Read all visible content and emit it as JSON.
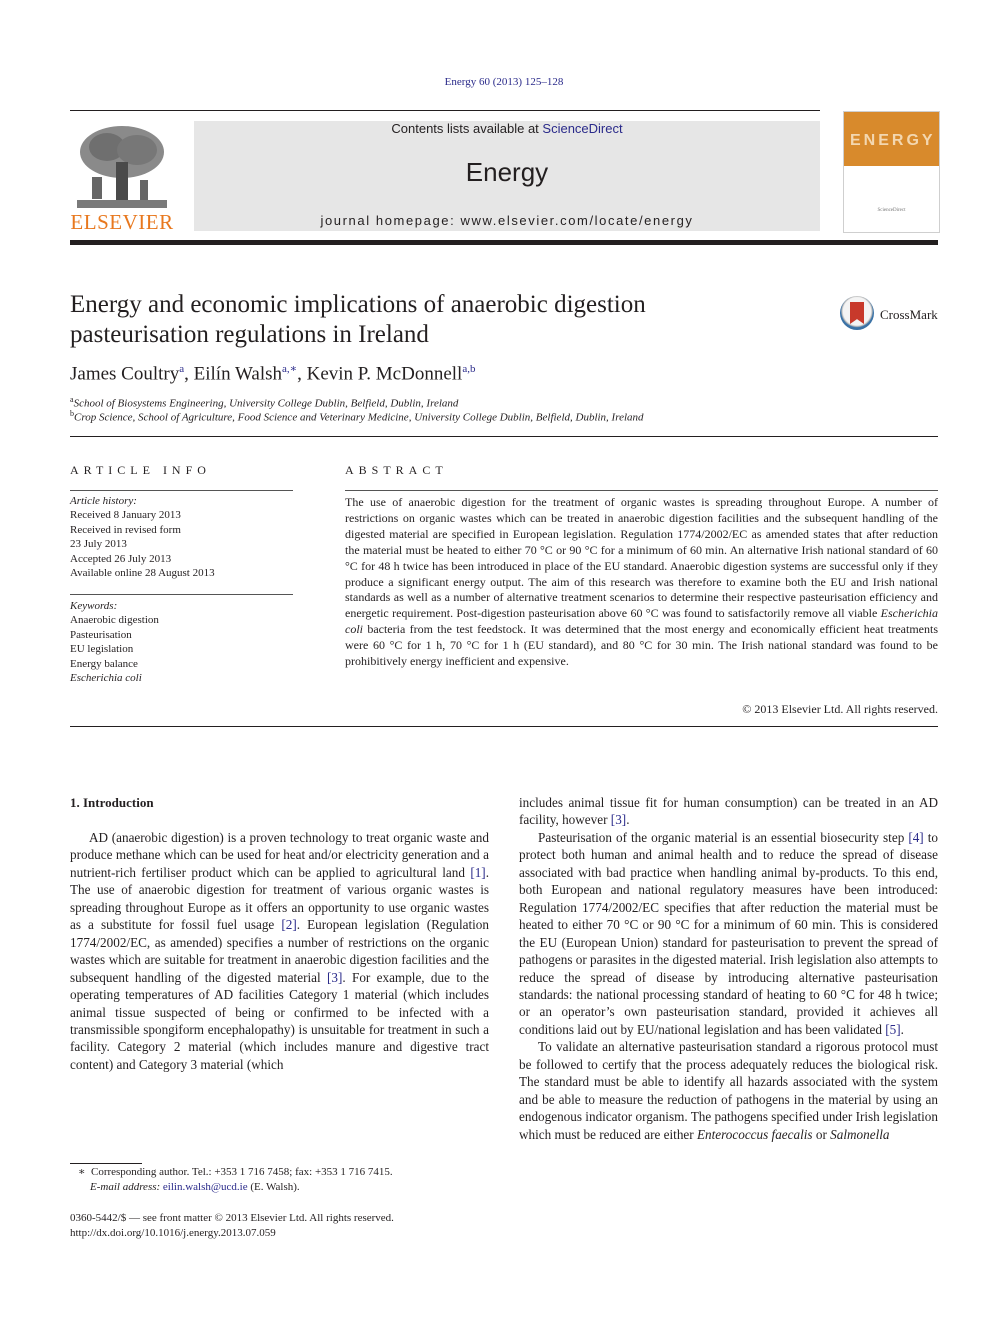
{
  "header": {
    "citation": "Energy 60 (2013) 125–128",
    "publisher_logo_text": "ELSEVIER",
    "contents_prefix": "Contents lists available at ",
    "contents_link": "ScienceDirect",
    "journal_name": "Energy",
    "homepage": "journal homepage: www.elsevier.com/locate/energy",
    "cover_title": "ENERGY",
    "cover_sub": "ScienceDirect",
    "crossmark_label": "CrossMark"
  },
  "article": {
    "title_line1": "Energy and economic implications of anaerobic digestion",
    "title_line2": "pasteurisation regulations in Ireland",
    "authors": [
      {
        "name": "James Coultry",
        "sup": "a"
      },
      {
        "name": "Eilín Walsh",
        "sup": "a,∗"
      },
      {
        "name": "Kevin P. McDonnell",
        "sup": "a,b"
      }
    ],
    "affiliations": [
      {
        "mark": "a",
        "text": "School of Biosystems Engineering, University College Dublin, Belfield, Dublin, Ireland"
      },
      {
        "mark": "b",
        "text": "Crop Science, School of Agriculture, Food Science and Veterinary Medicine, University College Dublin, Belfield, Dublin, Ireland"
      }
    ]
  },
  "article_info": {
    "heading": "ARTICLE INFO",
    "history_label": "Article history:",
    "history": [
      "Received 8 January 2013",
      "Received in revised form",
      "23 July 2013",
      "Accepted 26 July 2013",
      "Available online 28 August 2013"
    ],
    "keywords_label": "Keywords:",
    "keywords": [
      "Anaerobic digestion",
      "Pasteurisation",
      "EU legislation",
      "Energy balance",
      "Escherichia coli"
    ]
  },
  "abstract": {
    "heading": "ABSTRACT",
    "text_part1": "The use of anaerobic digestion for the treatment of organic wastes is spreading throughout Europe. A number of restrictions on organic wastes which can be treated in anaerobic digestion facilities and the subsequent handling of the digested material are specified in European legislation. Regulation 1774/2002/EC as amended states that after reduction the material must be heated to either 70 °C or 90 °C for a minimum of 60 min. An alternative Irish national standard of 60 °C for 48 h twice has been introduced in place of the EU standard. Anaerobic digestion systems are successful only if they produce a significant energy output. The aim of this research was therefore to examine both the EU and Irish national standards as well as a number of alternative treatment scenarios to determine their respective pasteurisation efficiency and energetic requirement. Post-digestion pasteurisation above 60 °C was found to satisfactorily remove all viable ",
    "text_italic": "Escherichia coli",
    "text_part2": " bacteria from the test feedstock. It was determined that the most energy and economically efficient heat treatments were 60 °C for 1 h, 70 °C for 1 h (EU standard), and 80 °C for 30 min. The Irish national standard was found to be prohibitively energy inefficient and expensive.",
    "copyright": "© 2013 Elsevier Ltd. All rights reserved."
  },
  "body": {
    "section_heading": "1.  Introduction",
    "left": {
      "p1_a": "AD (anaerobic digestion) is a proven technology to treat organic waste and produce methane which can be used for heat and/or electricity generation and a nutrient-rich fertiliser product which can be applied to agricultural land ",
      "ref1": "[1]",
      "p1_b": ". The use of anaerobic digestion for treatment of various organic wastes is spreading throughout Europe as it offers an opportunity to use organic wastes as a substitute for fossil fuel usage ",
      "ref2": "[2]",
      "p1_c": ". European legislation (Regulation 1774/2002/EC, as amended) specifies a number of restrictions on the organic wastes which are suitable for treatment in anaerobic digestion facilities and the subsequent handling of the digested material ",
      "ref3": "[3]",
      "p1_d": ". For example, due to the operating temperatures of AD facilities Category 1 material (which includes animal tissue suspected of being or confirmed to be infected with a transmissible spongiform encephalopathy) is unsuitable for treatment in such a facility. Category 2 material (which includes manure and digestive tract content) and Category 3 material (which"
    },
    "right": {
      "p0_a": "includes animal tissue fit for human consumption) can be treated in an AD facility, however ",
      "ref3": "[3]",
      "p0_b": ".",
      "p1_a": "Pasteurisation of the organic material is an essential biosecurity step ",
      "ref4": "[4]",
      "p1_b": " to protect both human and animal health and to reduce the spread of disease associated with bad practice when handling animal by-products. To this end, both European and national regulatory measures have been introduced: Regulation 1774/2002/EC specifies that after reduction the material must be heated to either 70 °C or 90 °C for a minimum of 60 min. This is considered the EU (European Union) standard for pasteurisation to prevent the spread of pathogens or parasites in the digested material. Irish legislation also attempts to reduce the spread of disease by introducing alternative pasteurisation standards: the national processing standard of heating to 60 °C for 48 h twice; or an operator’s own pasteurisation standard, provided it achieves all conditions laid out by EU/national legislation and has been validated ",
      "ref5": "[5]",
      "p1_c": ".",
      "p2_a": "To validate an alternative pasteurisation standard a rigorous protocol must be followed to certify that the process adequately reduces the biological risk. The standard must be able to identify all hazards associated with the system and be able to measure the reduction of pathogens in the material by using an endogenous indicator organism. The pathogens specified under Irish legislation which must be reduced are either ",
      "p2_ital1": "Enterococcus faecalis",
      "p2_b": " or ",
      "p2_ital2": "Salmonella"
    }
  },
  "footnotes": {
    "star": "∗",
    "corresponding": "Corresponding author. Tel.: +353 1 716 7458; fax: +353 1 716 7415.",
    "email_label": "E-mail address:",
    "email": "eilin.walsh@ucd.ie",
    "email_suffix": " (E. Walsh).",
    "front_matter": "0360-5442/$ — see front matter © 2013 Elsevier Ltd. All rights reserved.",
    "doi": "http://dx.doi.org/10.1016/j.energy.2013.07.059"
  }
}
